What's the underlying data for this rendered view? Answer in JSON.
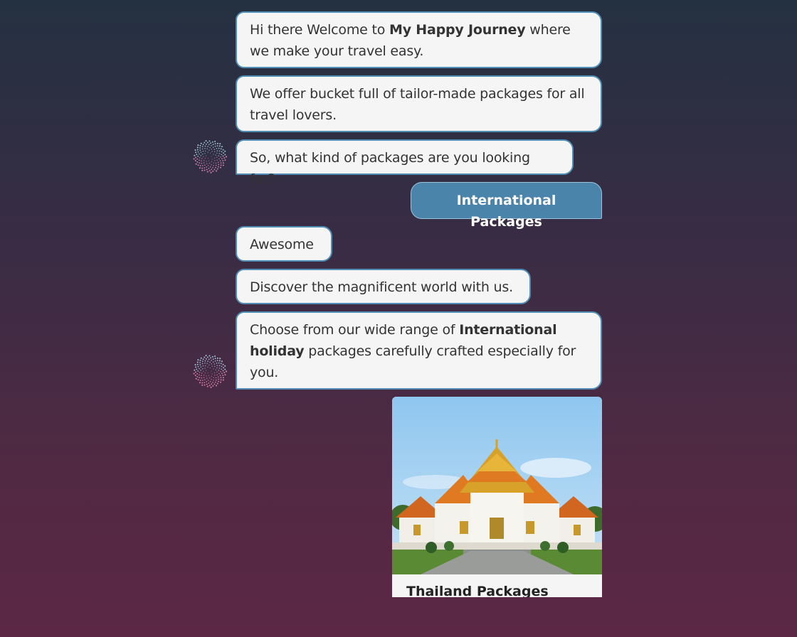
{
  "messages": {
    "m1": {
      "pre": "Hi there Welcome to ",
      "bold": "My Happy Journey",
      "post": " where we make your travel easy."
    },
    "m2": "We offer bucket full of tailor-made packages for all travel lovers.",
    "m3": "So, what kind of packages are you looking for?",
    "user_reply": "International Packages",
    "m4": "Awesome",
    "m5": "Discover the magnificent world with us.",
    "m6": {
      "pre": "Choose from our wide range of ",
      "bold": "International holiday",
      "post": " packages carefully crafted especially for you."
    }
  },
  "card": {
    "title": "Thailand Packages",
    "image_icon": "thai-temple-image"
  },
  "colors": {
    "bot_bubble_bg": "#f5f5f6",
    "bot_bubble_border": "#4f8db5",
    "user_bubble_bg": "#4b84aa",
    "bg_top": "#243141",
    "bg_bottom": "#5b2744"
  },
  "avatar_icon": "spiral-dots-avatar-icon"
}
